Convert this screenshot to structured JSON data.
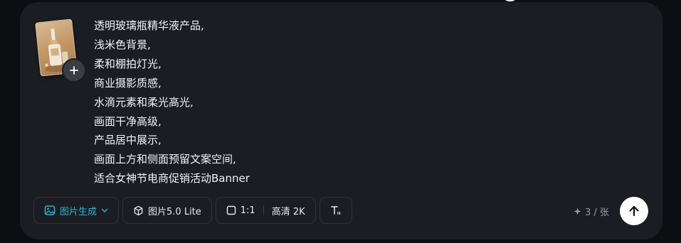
{
  "prompt_lines": [
    "透明玻璃瓶精华液产品,",
    "浅米色背景,",
    "柔和棚拍灯光,",
    "商业摄影质感,",
    "水滴元素和柔光高光,",
    "画面干净高级,",
    "产品居中展示,",
    "画面上方和侧面预留文案空间,",
    "适合女神节电商促销活动Banner"
  ],
  "toolbar": {
    "mode_label": "图片生成",
    "model_label": "图片5.0 Lite",
    "ratio_label": "1:1",
    "quality_label": "高清 2K"
  },
  "credits": {
    "text": "3 / 张"
  },
  "colors": {
    "accent": "#22b6d0",
    "card_bg": "#1c1d22",
    "page_bg": "#0d0e11"
  },
  "icons": {
    "add": "plus-icon",
    "mode": "image-icon",
    "dropdown": "chevron-down-icon",
    "model": "cube-icon",
    "ratio": "square-icon",
    "text_style": "text-format-icon",
    "credits": "sparkle-icon",
    "send": "arrow-up-icon"
  }
}
